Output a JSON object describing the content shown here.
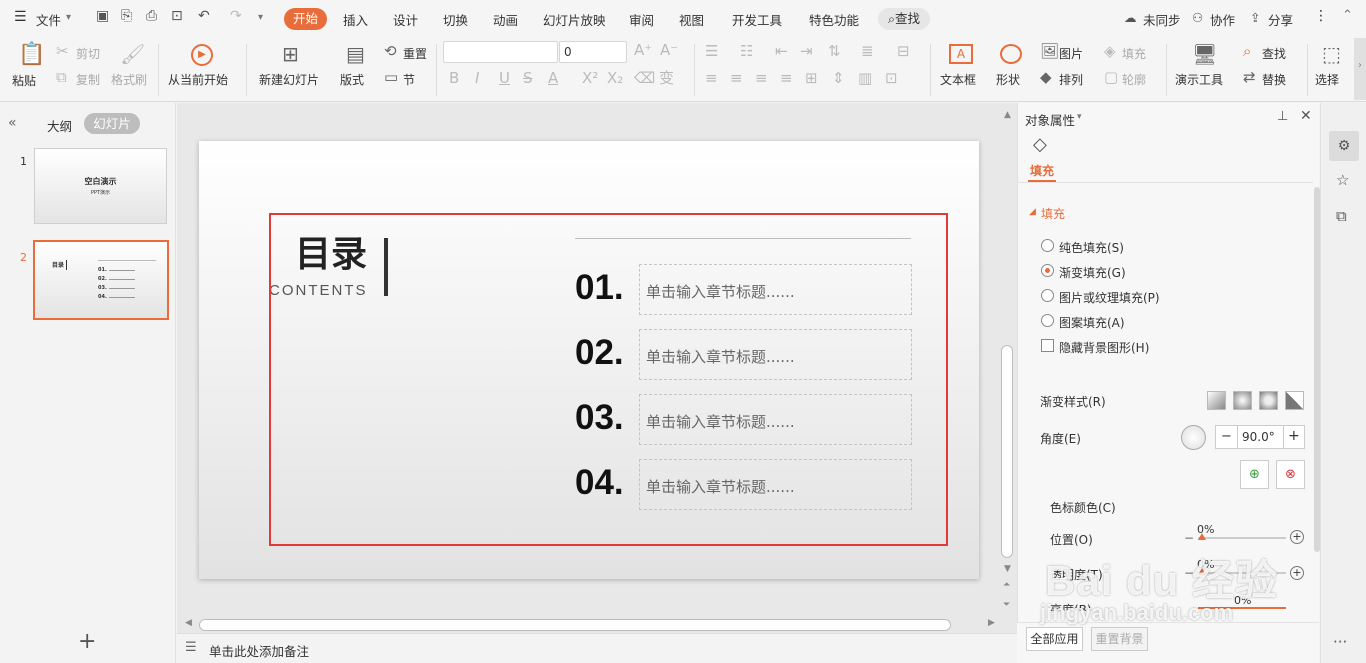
{
  "menu": {
    "file": "文件",
    "tabs": [
      "开始",
      "插入",
      "设计",
      "切换",
      "动画",
      "幻灯片放映",
      "审阅",
      "视图",
      "开发工具",
      "特色功能"
    ],
    "search": "查找",
    "sync": "未同步",
    "collab": "协作",
    "share": "分享"
  },
  "ribbon": {
    "paste": "粘贴",
    "cut": "剪切",
    "copy": "复制",
    "format_painter": "格式刷",
    "play_from_current": "从当前开始",
    "new_slide": "新建幻灯片",
    "layout": "版式",
    "reset": "重置",
    "section": "节",
    "font_size": "0",
    "textbox": "文本框",
    "shape": "形状",
    "picture": "图片",
    "fill": "填充",
    "arrange": "排列",
    "outline": "轮廓",
    "present_tools": "演示工具",
    "find": "查找",
    "replace": "替换",
    "select": "选择"
  },
  "left_pane": {
    "tab_outline": "大纲",
    "tab_slides": "幻灯片",
    "slide1_num": "1",
    "slide1_title": "空白演示",
    "slide1_sub": "PPT演示",
    "slide2_num": "2",
    "slide2_title": "目录",
    "slide2_items": [
      "01.",
      "02.",
      "03.",
      "04."
    ]
  },
  "slide": {
    "title": "目录",
    "subtitle": "CONTENTS",
    "items": [
      {
        "num": "01.",
        "text": "单击输入章节标题......"
      },
      {
        "num": "02.",
        "text": "单击输入章节标题......"
      },
      {
        "num": "03.",
        "text": "单击输入章节标题......"
      },
      {
        "num": "04.",
        "text": "单击输入章节标题......"
      }
    ]
  },
  "notes_placeholder": "单击此处添加备注",
  "props": {
    "header": "对象属性",
    "tab_fill": "填充",
    "section_fill": "填充",
    "options": [
      {
        "label": "纯色填充(S)",
        "checked": false
      },
      {
        "label": "渐变填充(G)",
        "checked": true
      },
      {
        "label": "图片或纹理填充(P)",
        "checked": false
      },
      {
        "label": "图案填充(A)",
        "checked": false
      }
    ],
    "hide_bg": "隐藏背景图形(H)",
    "gradient_style": "渐变样式(R)",
    "angle_label": "角度(E)",
    "angle_value": "90.0°",
    "stop_color": "色标颜色(C)",
    "position_label": "位置(O)",
    "position_value": "0%",
    "transparency_label": "透明度(T)",
    "transparency_value": "0%",
    "brightness_label": "亮度(B)",
    "brightness_value": "0%",
    "apply_all": "全部应用",
    "reset_bg": "重置背景"
  },
  "watermark": {
    "logo": "Bai du 经验",
    "url": "jingyan.baidu.com"
  },
  "colors": {
    "accent": "#e96d3a",
    "selection": "#e03a3a",
    "thumb_selected": "#e96d3a"
  }
}
